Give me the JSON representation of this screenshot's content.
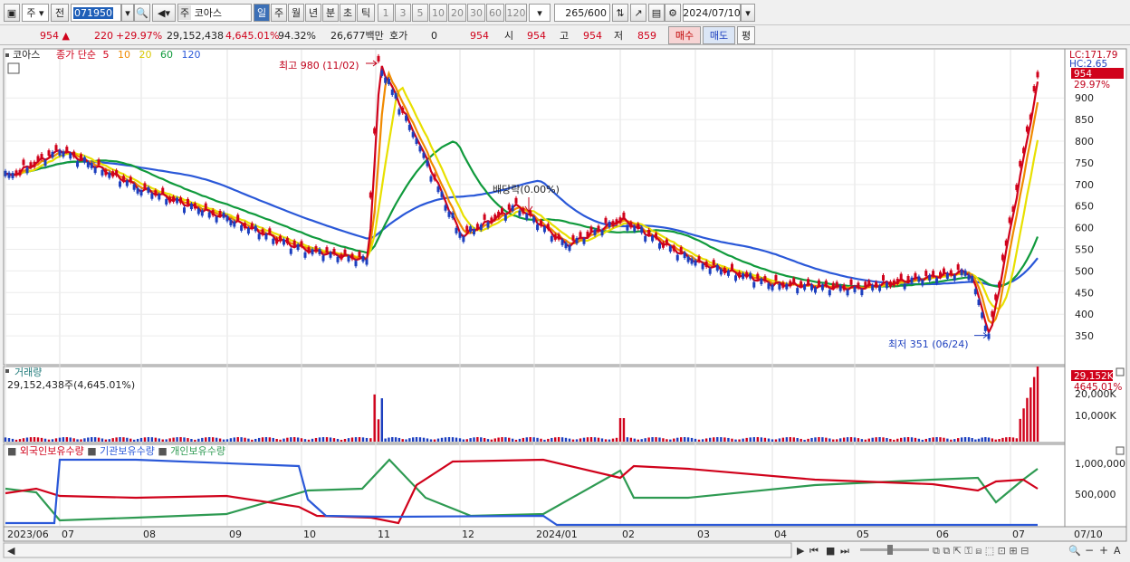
{
  "toolbar": {
    "market": "주",
    "prev_label": "전",
    "code": "071950",
    "stock_tag": "주",
    "stock_name": "코아스",
    "periods": [
      "일",
      "주",
      "월",
      "년",
      "분",
      "초",
      "틱"
    ],
    "active_period": "일",
    "intervals": [
      "1",
      "3",
      "5",
      "10",
      "20",
      "30",
      "60",
      "120"
    ],
    "count": "265",
    "total": "/600",
    "date": "2024/07/10"
  },
  "quote": {
    "price": "954",
    "change": "220",
    "change_pct": "+29.97%",
    "volume": "29,152,438",
    "volume_ratio": "4,645.01%",
    "turnover": "94.32%",
    "amount": "26,677백만",
    "hoga_label": "호가",
    "hoga_value": "0",
    "hoga_price": "954",
    "open_label": "시",
    "open": "954",
    "high_label": "고",
    "high": "954",
    "low_label": "저",
    "low": "859",
    "buy_label": "매수",
    "sell_label": "매도",
    "avg_label": "평"
  },
  "chart_data": {
    "type": "line",
    "price_panel": {
      "name": "코아스",
      "legend_prefix": "종가 단순",
      "ma_periods": [
        "5",
        "10",
        "20",
        "60",
        "120"
      ],
      "ma_colors": [
        "#d0021b",
        "#f08a00",
        "#e8e000",
        "#109a3c",
        "#2a58d8"
      ],
      "y_ticks": [
        350,
        400,
        450,
        500,
        550,
        600,
        650,
        700,
        750,
        800,
        850,
        900
      ],
      "ylim": [
        300,
        980
      ],
      "lc_label": "LC:171.79",
      "hc_label": "HC:2.65",
      "last_price_label": "954",
      "last_pct_label": "29.97%",
      "annotations": {
        "high": "최고 980 (11/02)",
        "low": "최저 351 (06/24)",
        "dividend": "배당락(0.00%)"
      }
    },
    "volume_panel": {
      "title": "거래량",
      "summary": "29,152,438주(4,645.01%)",
      "y_ticks": [
        "10,000K",
        "20,000K"
      ],
      "badge": "29,152K",
      "badge_pct": "4645.01%"
    },
    "holdings_panel": {
      "series_names": [
        "외국인보유수량",
        "기관보유수량",
        "개인보유수량"
      ],
      "series_colors": [
        "#d0021b",
        "#2a58d8",
        "#2e9a52"
      ],
      "y_ticks": [
        "500,000",
        "1,000,000"
      ]
    },
    "x_axis": {
      "labels": [
        "2023/06",
        "07",
        "08",
        "09",
        "10",
        "11",
        "12",
        "2024/01",
        "02",
        "03",
        "04",
        "05",
        "06",
        "07"
      ],
      "last_label": "07/10"
    },
    "key_points": [
      {
        "date": "2023/06",
        "close": 715
      },
      {
        "date": "2023/07",
        "close": 780
      },
      {
        "date": "2023/08",
        "close": 690
      },
      {
        "date": "2023/09",
        "close": 620
      },
      {
        "date": "2023/10",
        "close": 550
      },
      {
        "date": "2023/10/31",
        "close": 525
      },
      {
        "date": "2023/11/02",
        "close": 980
      },
      {
        "date": "2023/11",
        "close": 800
      },
      {
        "date": "2023/12",
        "close": 580
      },
      {
        "date": "2023/12/20",
        "close": 650
      },
      {
        "date": "2024/01",
        "close": 560
      },
      {
        "date": "2024/02",
        "close": 620
      },
      {
        "date": "2024/03",
        "close": 520
      },
      {
        "date": "2024/04",
        "close": 470
      },
      {
        "date": "2024/05",
        "close": 460
      },
      {
        "date": "2024/06",
        "close": 500
      },
      {
        "date": "2024/06/24",
        "close": 351
      },
      {
        "date": "2024/07/10",
        "close": 954
      }
    ]
  }
}
